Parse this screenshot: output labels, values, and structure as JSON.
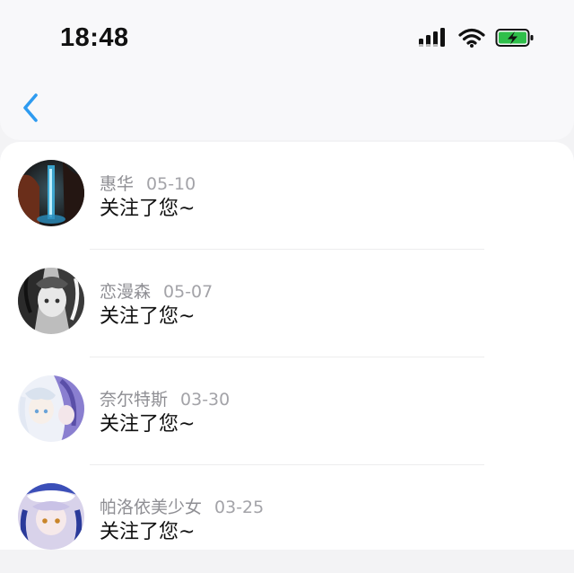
{
  "status_bar": {
    "time": "18:48",
    "icons": [
      "signal-icon",
      "wifi-icon",
      "battery-charging-icon"
    ],
    "battery_color": "#2fbf4a"
  },
  "nav": {
    "back_icon": "chevron-left-icon",
    "accent_color": "#2e9bf0"
  },
  "notifications": [
    {
      "name": "惠华",
      "date": "05-10",
      "message": "关注了您~"
    },
    {
      "name": "恋漫森",
      "date": "05-07",
      "message": "关注了您~"
    },
    {
      "name": "奈尔特斯",
      "date": "03-30",
      "message": "关注了您~"
    },
    {
      "name": "帕洛依美少女",
      "date": "03-25",
      "message": "关注了您~"
    }
  ]
}
